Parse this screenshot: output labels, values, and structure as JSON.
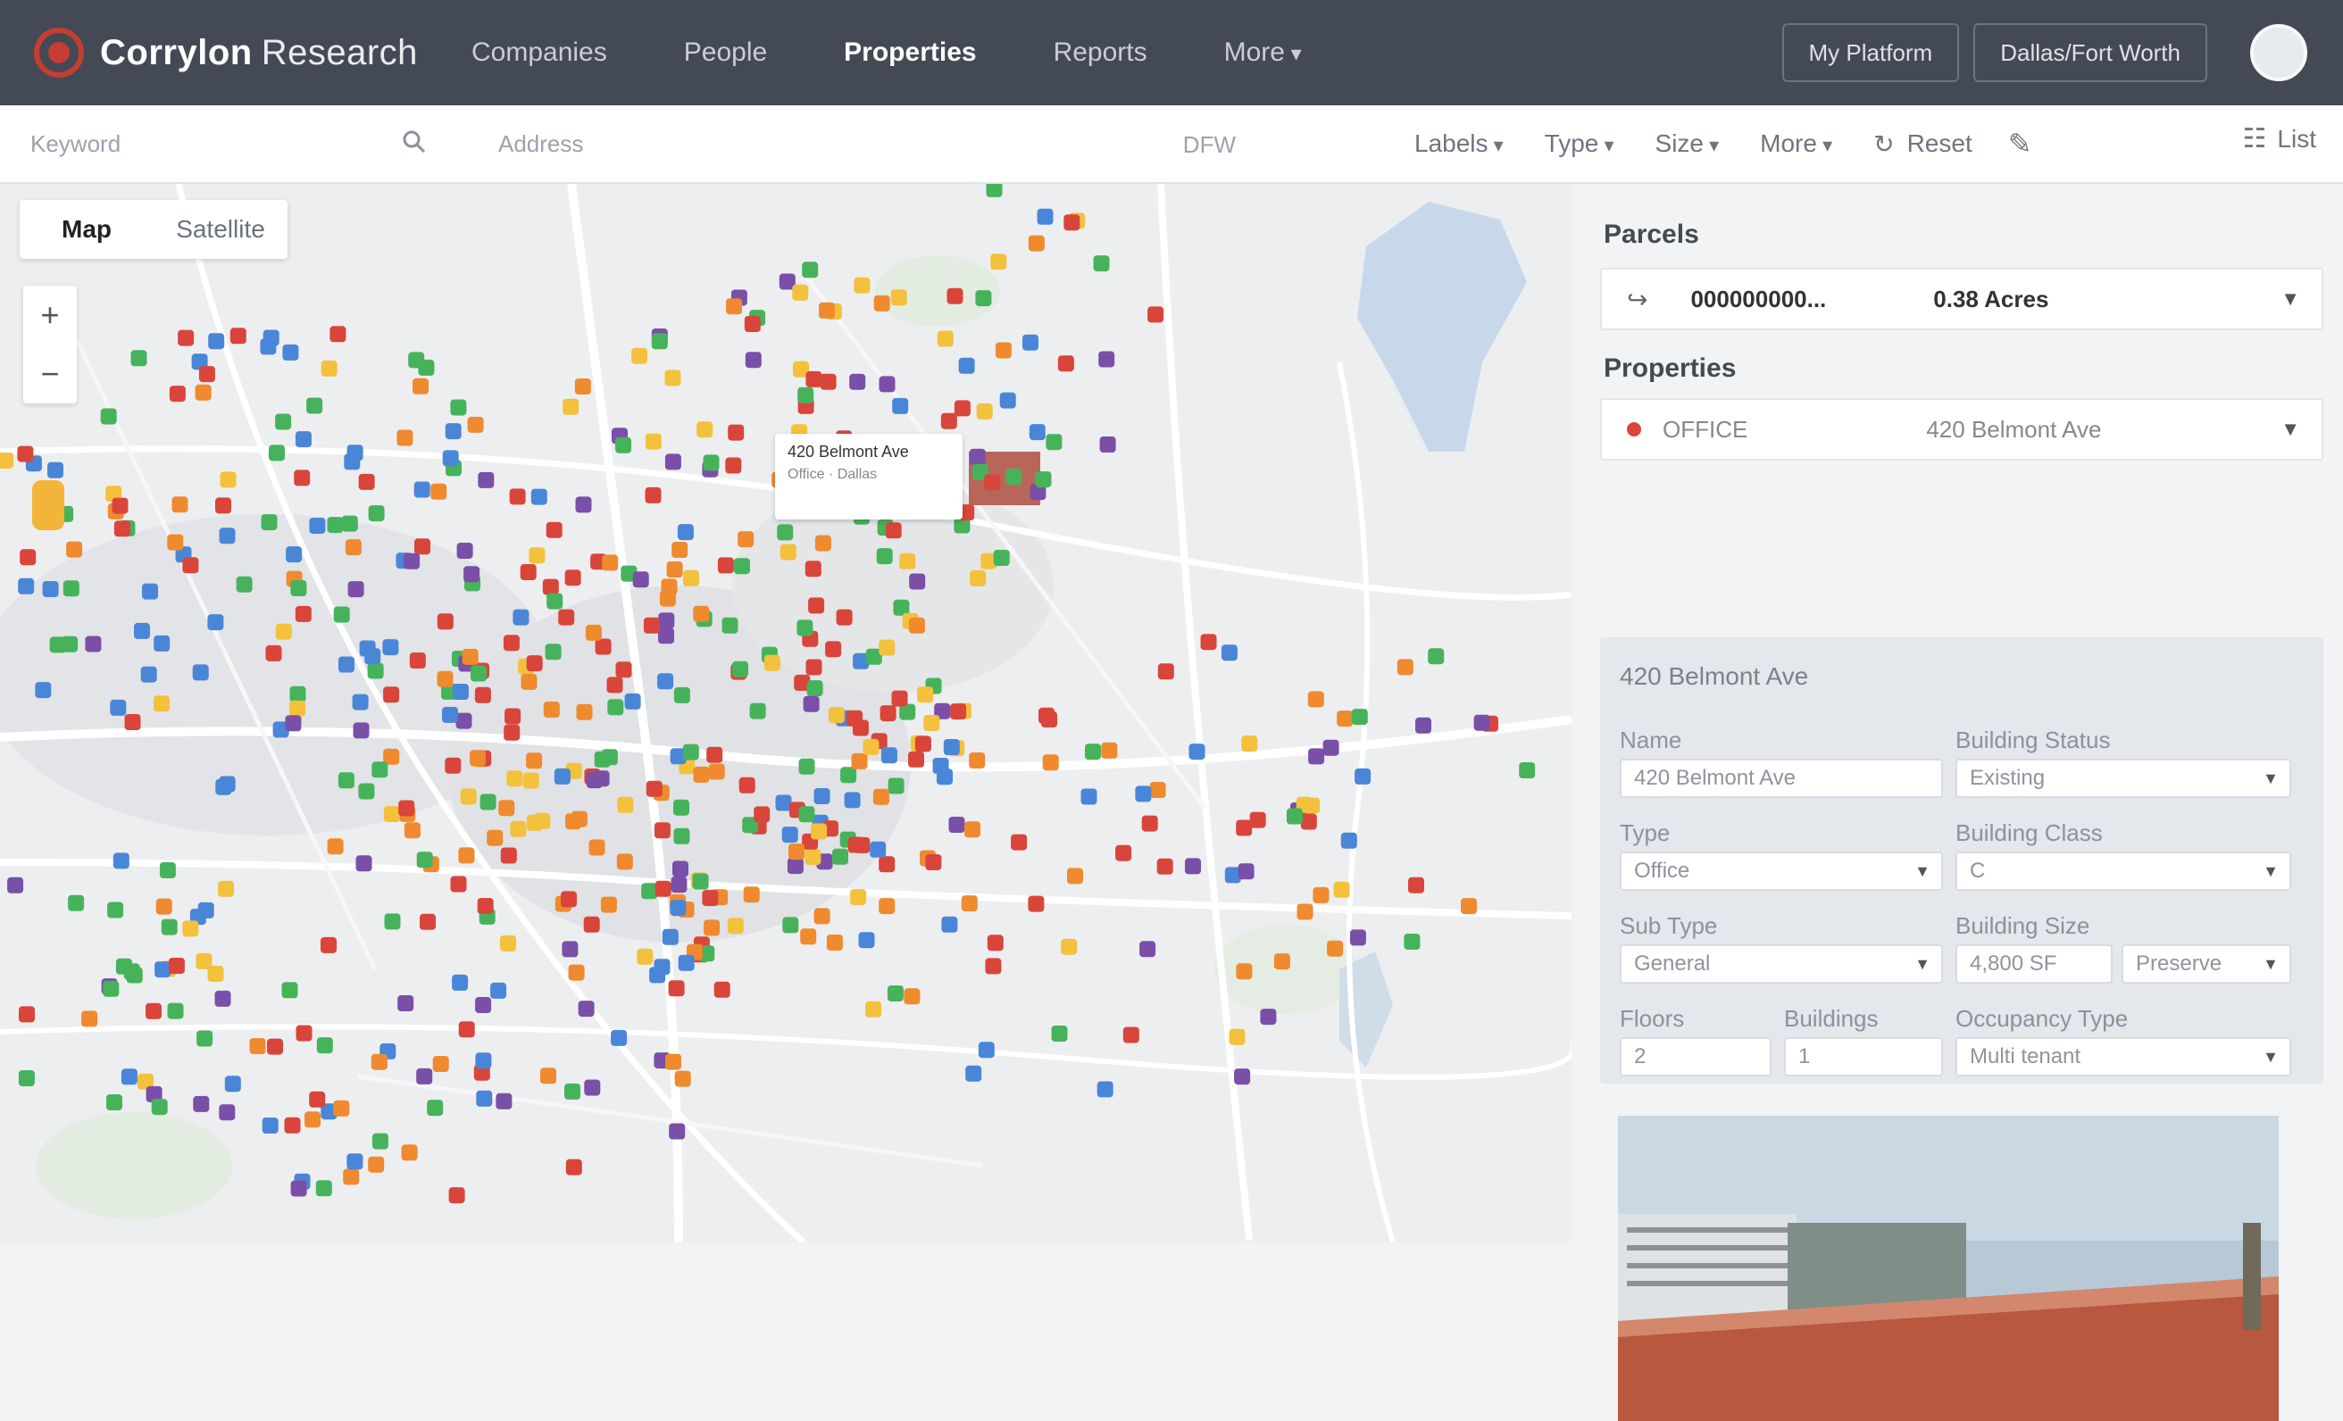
{
  "brand": {
    "name": "Corrylon",
    "suffix": "Research"
  },
  "nav": {
    "items": [
      {
        "label": "Companies",
        "active": false
      },
      {
        "label": "People",
        "active": false
      },
      {
        "label": "Properties",
        "active": true
      },
      {
        "label": "Reports",
        "active": false
      },
      {
        "label": "More",
        "active": false
      }
    ]
  },
  "top_actions": {
    "platform_label": "My Platform",
    "location_label": "Dallas/Fort Worth"
  },
  "filters": {
    "keyword_placeholder": "Keyword",
    "address_placeholder": "Address",
    "geo_label": "DFW",
    "labels": "Labels",
    "type": "Type",
    "size": "Size",
    "more": "More",
    "reset": "Reset",
    "list": "List"
  },
  "map": {
    "toggle_map": "Map",
    "toggle_satellite": "Satellite",
    "popup_title": "420 Belmont Ave",
    "popup_sub": "Office · Dallas",
    "marker_colors": {
      "red": "#d9453a",
      "green": "#46b35b",
      "blue": "#4a86d8",
      "orange": "#ef8a2f",
      "yellow": "#f4c13c",
      "purple": "#7a4fa8"
    }
  },
  "panel": {
    "parcels_title": "Parcels",
    "parcel_id": "000000000...",
    "parcel_acres": "0.38 Acres",
    "properties_title": "Properties",
    "property_type": "OFFICE",
    "property_name": "420 Belmont Ave",
    "detail_title": "420 Belmont Ave",
    "fields": {
      "name_label": "Name",
      "name_value": "420 Belmont Ave",
      "status_label": "Building Status",
      "status_value": "Existing",
      "type_label": "Type",
      "type_value": "Office",
      "class_label": "Building Class",
      "class_value": "C",
      "subtype_label": "Sub Type",
      "subtype_value": "General",
      "size_label": "Building Size",
      "size_value": "4,800 SF",
      "size_unit": "Preserve",
      "floors_label": "Floors",
      "floors_value": "2",
      "buildings_label": "Buildings",
      "buildings_value": "1",
      "occupancy_label": "Occupancy Type",
      "occupancy_value": "Multi tenant"
    }
  }
}
